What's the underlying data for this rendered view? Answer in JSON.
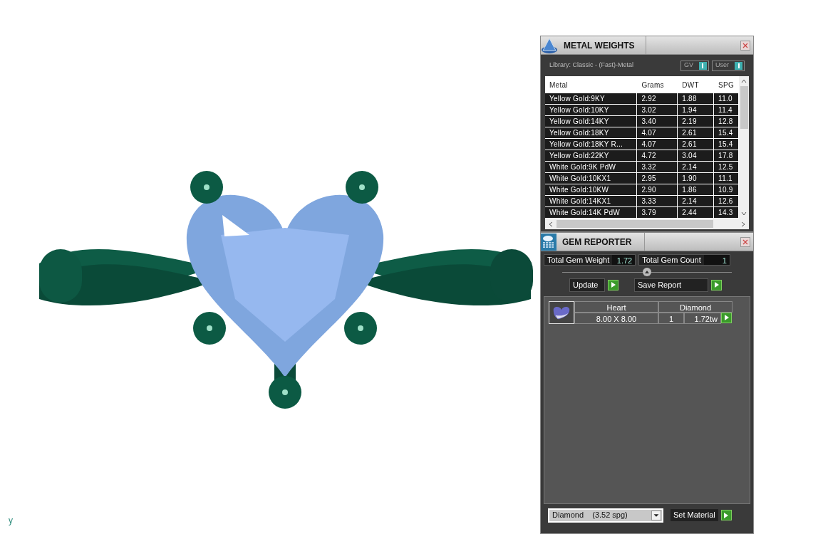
{
  "viewport": {
    "axis_label": "y"
  },
  "metal_weights": {
    "title": "METAL WEIGHTS",
    "library": "Library: Classic - (Fast)-Metal",
    "toggles": [
      {
        "label": "GV",
        "on": true
      },
      {
        "label": "User",
        "on": true
      }
    ],
    "table": {
      "columns": [
        "Metal",
        "Grams",
        "DWT",
        "SPG"
      ],
      "rows": [
        [
          "Yellow Gold:9KY",
          "2.92",
          "1.88",
          "11.0"
        ],
        [
          "Yellow Gold:10KY",
          "3.02",
          "1.94",
          "11.4"
        ],
        [
          "Yellow Gold:14KY",
          "3.40",
          "2.19",
          "12.8"
        ],
        [
          "Yellow Gold:18KY",
          "4.07",
          "2.61",
          "15.4"
        ],
        [
          "Yellow Gold:18KY R...",
          "4.07",
          "2.61",
          "15.4"
        ],
        [
          "Yellow Gold:22KY",
          "4.72",
          "3.04",
          "17.8"
        ],
        [
          "White Gold:9K PdW",
          "3.32",
          "2.14",
          "12.5"
        ],
        [
          "White Gold:10KX1",
          "2.95",
          "1.90",
          "11.1"
        ],
        [
          "White Gold:10KW",
          "2.90",
          "1.86",
          "10.9"
        ],
        [
          "White Gold:14KX1",
          "3.33",
          "2.14",
          "12.6"
        ],
        [
          "White Gold:14K PdW",
          "3.79",
          "2.44",
          "14.3"
        ]
      ]
    }
  },
  "gem_reporter": {
    "title": "GEM REPORTER",
    "total_weight": {
      "label": "Total Gem Weight",
      "value": "1.72"
    },
    "total_count": {
      "label": "Total Gem Count",
      "value": "1"
    },
    "buttons": [
      "Update",
      "Save Report"
    ],
    "gems": [
      {
        "shape": "Heart",
        "size": "8.00 X 8.00",
        "material": "Diamond",
        "count": "1",
        "weight": "1.72tw"
      }
    ],
    "material_select": {
      "value": "Diamond    (3.52 spg)"
    },
    "set_material": "Set Material"
  }
}
